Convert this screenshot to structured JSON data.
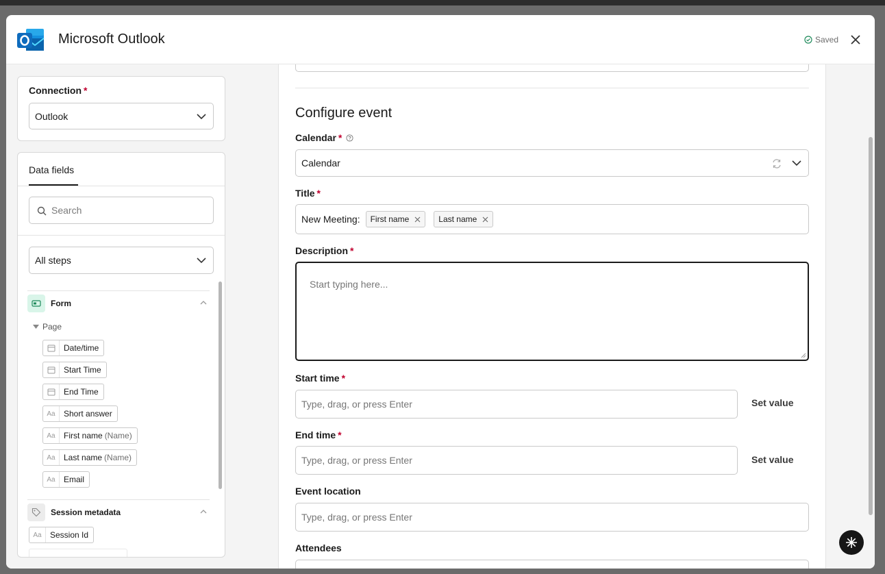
{
  "header": {
    "app_title": "Microsoft Outlook",
    "saved_status": "Saved",
    "logo_icon": "outlook-logo"
  },
  "connection": {
    "label": "Connection",
    "required_mark": "*",
    "value": "Outlook"
  },
  "data_fields": {
    "tab_label": "Data fields",
    "search_placeholder": "Search",
    "steps_filter": "All steps",
    "groups": [
      {
        "name": "Form",
        "icon": "form-icon",
        "subgroup": "Page",
        "items": [
          {
            "icon": "calendar-icon",
            "label": "Date/time",
            "suffix": ""
          },
          {
            "icon": "calendar-icon",
            "label": "Start Time",
            "suffix": ""
          },
          {
            "icon": "calendar-icon",
            "label": "End Time",
            "suffix": ""
          },
          {
            "icon": "text-icon",
            "label": "Short answer",
            "suffix": ""
          },
          {
            "icon": "text-icon",
            "label": "First name",
            "suffix": "(Name)"
          },
          {
            "icon": "text-icon",
            "label": "Last name",
            "suffix": "(Name)"
          },
          {
            "icon": "text-icon",
            "label": "Email",
            "suffix": ""
          }
        ]
      },
      {
        "name": "Session metadata",
        "icon": "tag-icon",
        "items": [
          {
            "icon": "text-icon",
            "label": "Session Id",
            "suffix": ""
          }
        ]
      }
    ]
  },
  "configure_event": {
    "section_title": "Configure event",
    "calendar": {
      "label": "Calendar",
      "value": "Calendar"
    },
    "title": {
      "label": "Title",
      "prefix": "New Meeting:",
      "tokens": [
        "First name",
        "Last name"
      ]
    },
    "description": {
      "label": "Description",
      "placeholder": "Start typing here..."
    },
    "start_time": {
      "label": "Start time",
      "placeholder": "Type, drag, or press Enter",
      "action": "Set value"
    },
    "end_time": {
      "label": "End time",
      "placeholder": "Type, drag, or press Enter",
      "action": "Set value"
    },
    "event_location": {
      "label": "Event location",
      "placeholder": "Type, drag, or press Enter"
    },
    "attendees": {
      "label": "Attendees"
    }
  },
  "colors": {
    "required": "#c0002e",
    "form_icon_bg": "#d9f5e9",
    "form_icon_fg": "#1f8a5b",
    "fab_bg": "#161616"
  }
}
